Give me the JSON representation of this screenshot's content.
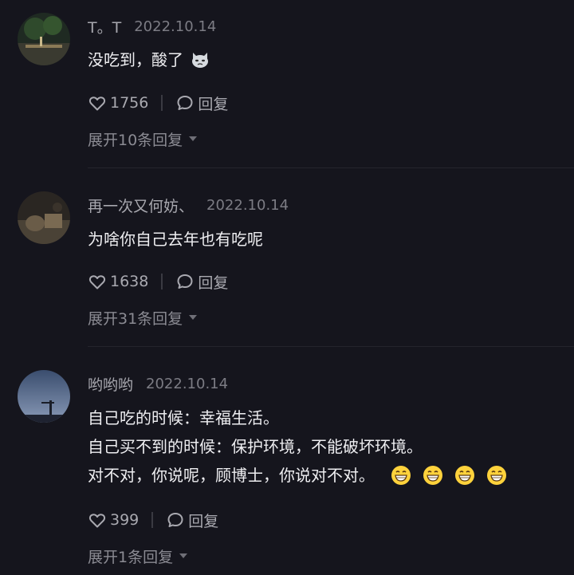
{
  "comments": [
    {
      "username": "T。T",
      "date": "2022.10.14",
      "lines": [
        "没吃到，酸了"
      ],
      "inline_emoji": "cat-face-emoji",
      "likes": "1756",
      "reply_label": "回复",
      "expand_label": "展开10条回复"
    },
    {
      "username": "再一次又何妨、",
      "date": "2022.10.14",
      "lines": [
        "为啥你自己去年也有吃呢"
      ],
      "likes": "1638",
      "reply_label": "回复",
      "expand_label": "展开31条回复"
    },
    {
      "username": "哟哟哟",
      "date": "2022.10.14",
      "lines": [
        "自己吃的时候：幸福生活。",
        "自己买不到的时候：保护环境，不能破坏环境。",
        "对不对，你说呢，顾博士，你说对不对。"
      ],
      "trailing_emojis": [
        "grin-emoji",
        "grin-emoji",
        "grin-emoji",
        "grin-emoji"
      ],
      "likes": "399",
      "reply_label": "回复",
      "expand_label": "展开1条回复"
    }
  ],
  "colors": {
    "background": "#15151d",
    "username": "#a7a7ae",
    "date": "#7c7c84",
    "text": "#eeeef1",
    "action": "#a9a9b0"
  }
}
